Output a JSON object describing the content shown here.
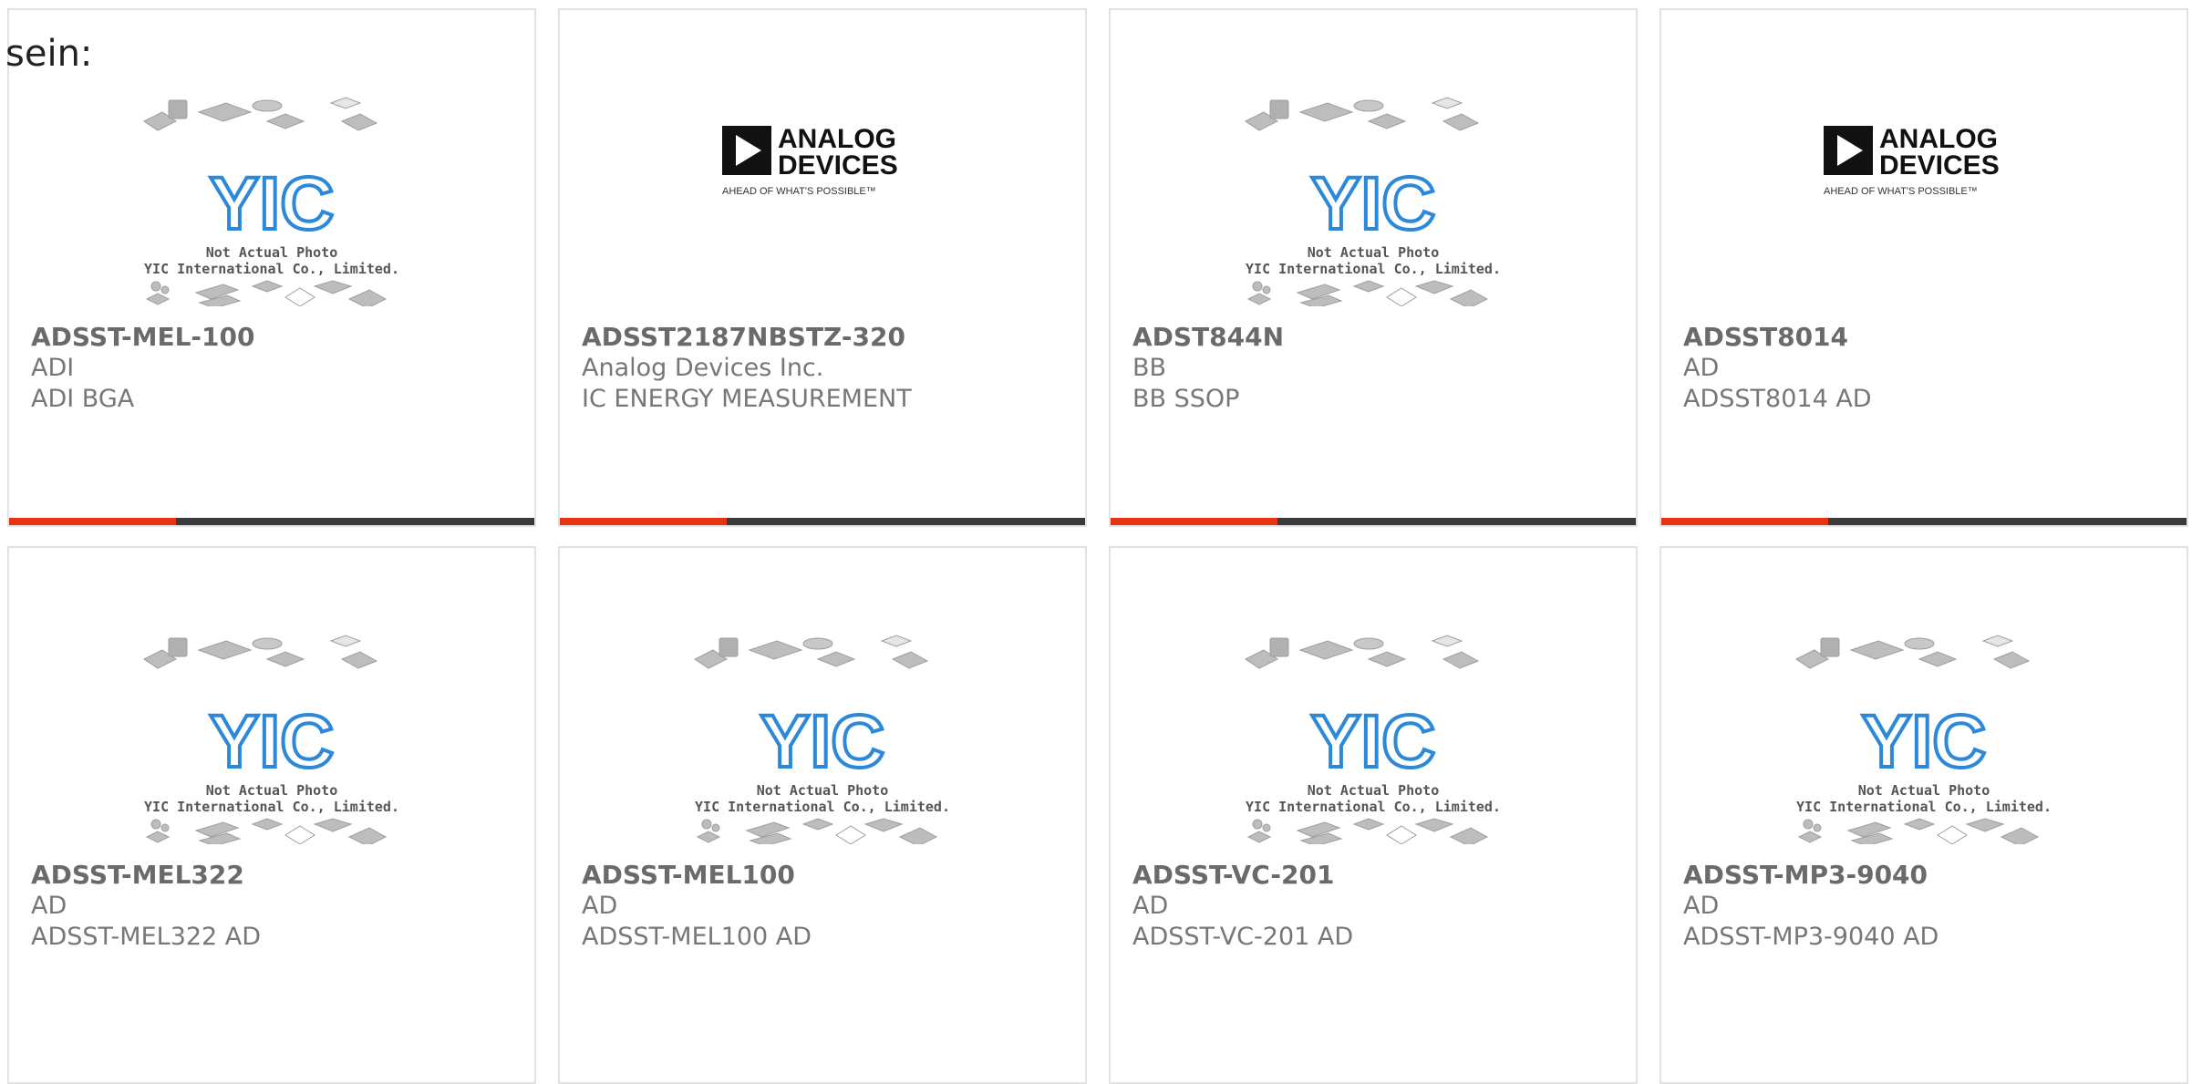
{
  "intro_text": "sein:",
  "placeholder": {
    "line1": "Not Actual Photo",
    "line2": "YIC International Co., Limited.",
    "logo": "YIC"
  },
  "adi_logo": {
    "line1": "ANALOG",
    "line2": "DEVICES",
    "tagline": "AHEAD OF WHAT'S POSSIBLE™"
  },
  "colors": {
    "accent": "#e63312",
    "bar": "#3a3a3a",
    "border": "#e2e2e2",
    "yic_blue": "#2c88d9"
  },
  "products": [
    {
      "part": "ADSST-MEL-100",
      "brand": "ADI",
      "desc": "ADI BGA",
      "image": "placeholder"
    },
    {
      "part": "ADSST2187NBSTZ-320",
      "brand": "Analog Devices Inc.",
      "desc": "IC ENERGY MEASUREMENT",
      "image": "adi-logo"
    },
    {
      "part": "ADST844N",
      "brand": "BB",
      "desc": "BB SSOP",
      "image": "placeholder"
    },
    {
      "part": "ADSST8014",
      "brand": "AD",
      "desc": "ADSST8014 AD",
      "image": "adi-logo"
    },
    {
      "part": "ADSST-MEL322",
      "brand": "AD",
      "desc": "ADSST-MEL322 AD",
      "image": "placeholder"
    },
    {
      "part": "ADSST-MEL100",
      "brand": "AD",
      "desc": "ADSST-MEL100 AD",
      "image": "placeholder"
    },
    {
      "part": "ADSST-VC-201",
      "brand": "AD",
      "desc": "ADSST-VC-201 AD",
      "image": "placeholder"
    },
    {
      "part": "ADSST-MP3-9040",
      "brand": "AD",
      "desc": "ADSST-MP3-9040 AD",
      "image": "placeholder"
    }
  ]
}
